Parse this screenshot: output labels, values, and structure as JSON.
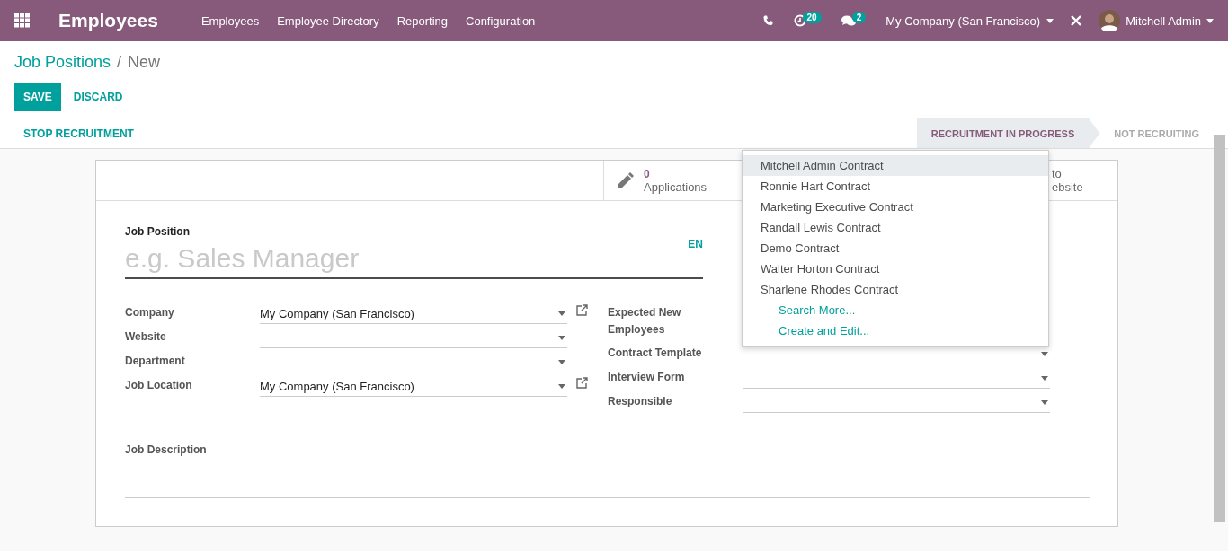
{
  "navbar": {
    "app_title": "Employees",
    "menu": [
      "Employees",
      "Employee Directory",
      "Reporting",
      "Configuration"
    ],
    "activity_count": "20",
    "message_count": "2",
    "company": "My Company (San Francisco)",
    "user": "Mitchell Admin"
  },
  "breadcrumb": {
    "parent": "Job Positions",
    "separator": "/",
    "current": "New"
  },
  "actions": {
    "save": "SAVE",
    "discard": "DISCARD"
  },
  "statusbar": {
    "action": "STOP RECRUITMENT",
    "stages": [
      {
        "label": "RECRUITMENT IN PROGRESS",
        "selected": true
      },
      {
        "label": "NOT RECRUITING",
        "selected": false
      }
    ]
  },
  "stat_buttons": {
    "applications": {
      "count": "0",
      "label": "Applications"
    },
    "website": {
      "line_1": "to",
      "line_2": "ebsite"
    }
  },
  "form": {
    "title_label": "Job Position",
    "title_placeholder": "e.g. Sales Manager",
    "language": "EN",
    "left_fields": [
      {
        "label": "Company",
        "value": "My Company (San Francisco)",
        "external_link": true
      },
      {
        "label": "Website",
        "external_link": false
      },
      {
        "label": "Department",
        "external_link": false
      },
      {
        "label": "Job Location",
        "value": "My Company (San Francisco)",
        "external_link": true
      }
    ],
    "right_fields": [
      {
        "label": "Expected New Employees"
      },
      {
        "label": "Contract Template",
        "focused": true
      },
      {
        "label": "Interview Form",
        "focused": false
      },
      {
        "label": "Responsible",
        "focused": false
      }
    ],
    "description_label": "Job Description"
  },
  "dropdown": {
    "options": [
      {
        "label": "Mitchell Admin Contract",
        "selected": true
      },
      {
        "label": "Ronnie Hart Contract",
        "selected": false
      },
      {
        "label": "Marketing Executive Contract",
        "selected": false
      },
      {
        "label": "Randall Lewis Contract",
        "selected": false
      },
      {
        "label": "Demo Contract",
        "selected": false
      },
      {
        "label": "Walter Horton Contract",
        "selected": false
      },
      {
        "label": "Sharlene Rhodes Contract",
        "selected": false
      }
    ],
    "links": [
      "Search More...",
      "Create and Edit..."
    ]
  }
}
